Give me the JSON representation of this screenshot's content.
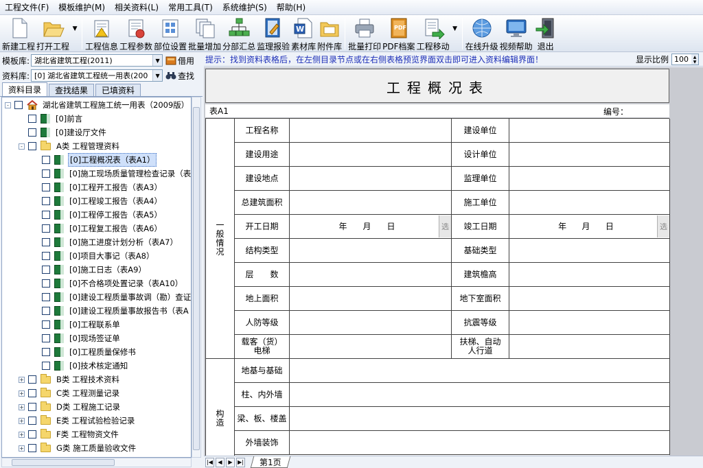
{
  "menu": [
    "工程文件(F)",
    "模板维护(M)",
    "相关资料(L)",
    "常用工具(T)",
    "系统维护(S)",
    "帮助(H)"
  ],
  "toolbar": {
    "new_project": "新建工程",
    "open_project": "打开工程",
    "project_info": "工程信息",
    "project_params": "工程参数",
    "part_settings": "部位设置",
    "batch_add": "批量增加",
    "subtotal": "分部汇总",
    "supervision_inspection": "监理报验",
    "material_library": "素材库",
    "attachment_library": "附件库",
    "batch_print": "批量打印",
    "pdf_archive": "PDF档案",
    "project_move": "工程移动",
    "online_upgrade": "在线升级",
    "video_help": "视频帮助",
    "exit": "退出"
  },
  "sidebar": {
    "template_label": "模板库:",
    "template_value": "湖北省建筑工程(2011)",
    "borrow_label": "借用",
    "library_label": "资料库:",
    "library_value": "[0] 湖北省建筑工程统一用表(200",
    "search_label": "查找",
    "tabs": [
      "资料目录",
      "查找结果",
      "已填资料"
    ],
    "tree": [
      {
        "text": "湖北省建筑工程施工统一用表（2009版）",
        "level": 0,
        "type": "root",
        "exp": "-"
      },
      {
        "text": "[0]前言",
        "level": 1,
        "type": "sheet"
      },
      {
        "text": "[0]建设厅文件",
        "level": 1,
        "type": "sheet"
      },
      {
        "text": "A类 工程管理资料",
        "level": 1,
        "type": "folder",
        "exp": "-"
      },
      {
        "text": "[0]工程概况表（表A1）",
        "level": 2,
        "type": "sheet",
        "selected": true
      },
      {
        "text": "[0]施工现场质量管理检查记录（表",
        "level": 2,
        "type": "sheet"
      },
      {
        "text": "[0]工程开工报告（表A3）",
        "level": 2,
        "type": "sheet"
      },
      {
        "text": "[0]工程竣工报告（表A4）",
        "level": 2,
        "type": "sheet"
      },
      {
        "text": "[0]工程停工报告（表A5）",
        "level": 2,
        "type": "sheet"
      },
      {
        "text": "[0]工程复工报告（表A6）",
        "level": 2,
        "type": "sheet"
      },
      {
        "text": "[0]施工进度计划分析（表A7）",
        "level": 2,
        "type": "sheet"
      },
      {
        "text": "[0]项目大事记（表A8）",
        "level": 2,
        "type": "sheet"
      },
      {
        "text": "[0]施工日志（表A9）",
        "level": 2,
        "type": "sheet"
      },
      {
        "text": "[0]不合格项处置记录（表A10）",
        "level": 2,
        "type": "sheet"
      },
      {
        "text": "[0]建设工程质量事故调（勘）查证",
        "level": 2,
        "type": "sheet"
      },
      {
        "text": "[0]建设工程质量事故报告书（表A",
        "level": 2,
        "type": "sheet"
      },
      {
        "text": "[0]工程联系单",
        "level": 2,
        "type": "sheet"
      },
      {
        "text": "[0]现场签证单",
        "level": 2,
        "type": "sheet"
      },
      {
        "text": "[0]工程质量保修书",
        "level": 2,
        "type": "sheet"
      },
      {
        "text": "[0]技术核定通知",
        "level": 2,
        "type": "sheet"
      },
      {
        "text": "B类 工程技术资料",
        "level": 1,
        "type": "folder",
        "exp": "+"
      },
      {
        "text": "C类 工程测量记录",
        "level": 1,
        "type": "folder",
        "exp": "+"
      },
      {
        "text": "D类 工程施工记录",
        "level": 1,
        "type": "folder",
        "exp": "+"
      },
      {
        "text": "E类 工程试验检验记录",
        "level": 1,
        "type": "folder",
        "exp": "+"
      },
      {
        "text": "F类 工程物资文件",
        "level": 1,
        "type": "folder",
        "exp": "+"
      },
      {
        "text": "G类 施工质量验收文件",
        "level": 1,
        "type": "folder",
        "exp": "+"
      }
    ]
  },
  "hint": "提示：找到资料表格后，在左侧目录节点或在右侧表格预览界面双击即可进入资料编辑界面！",
  "zoom_label": "显示比例",
  "zoom_value": "100",
  "form": {
    "title": "工程概况表",
    "form_no": "表A1",
    "number_label": "编号：",
    "section1": "一\n般\n情\n况",
    "section2": "构\n造",
    "rows": [
      {
        "l1": "工程名称",
        "l2": "建设单位"
      },
      {
        "l1": "建设用途",
        "l2": "设计单位"
      },
      {
        "l1": "建设地点",
        "l2": "监理单位"
      },
      {
        "l1": "总建筑面积",
        "l2": "施工单位"
      },
      {
        "l1": "开工日期",
        "l2": "竣工日期",
        "date": true
      },
      {
        "l1": "结构类型",
        "l2": "基础类型"
      },
      {
        "l1": "层　　数",
        "l2": "建筑檐高"
      },
      {
        "l1": "地上面积",
        "l2": "地下室面积"
      },
      {
        "l1": "人防等级",
        "l2": "抗震等级"
      },
      {
        "l1": "载客（货）\n电梯",
        "l2": "扶梯、自动\n人行道"
      }
    ],
    "date_text": [
      "年",
      "月",
      "日"
    ],
    "choose": "选",
    "rows2": [
      "地基与基础",
      "柱、内外墙",
      "梁、板、楼盖",
      "外墙装饰"
    ]
  },
  "sheet_tab": "第1页"
}
